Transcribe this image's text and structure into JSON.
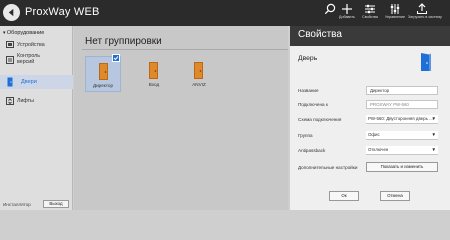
{
  "app": {
    "title": "ProxWay WEB"
  },
  "toolbar": {
    "buttons": [
      {
        "label": ""
      },
      {
        "label": "Добавить"
      },
      {
        "label": "Свойства"
      },
      {
        "label": "Управление"
      },
      {
        "label": "Загрузить в систему"
      }
    ]
  },
  "sidebar": {
    "group": "Оборудование",
    "items": [
      {
        "label": "Устройства"
      },
      {
        "label": "Контроль версий"
      }
    ],
    "doors": "Двери",
    "lifts": "Лифты",
    "user_label": "Инсталлятор",
    "logout_label": "Выход"
  },
  "main": {
    "group_title": "Нет группировки",
    "tiles": [
      {
        "label": "Директор",
        "selected": true
      },
      {
        "label": "Вход",
        "selected": false
      },
      {
        "label": "ANVIZ",
        "selected": false
      }
    ]
  },
  "panel": {
    "title": "Свойства",
    "subtitle": "Дверь",
    "fields": [
      {
        "label": "Название",
        "value": "Директор"
      },
      {
        "label": "Подключена к",
        "value": "PROXWAY PW-560"
      },
      {
        "label": "Схема подключения",
        "value": "PW-560: Двусторонняя дверь ..."
      },
      {
        "label": "Группа",
        "value": "Офис"
      },
      {
        "label": "Antipassback",
        "value": "Отключен"
      },
      {
        "label": "Дополнительные настройки",
        "value": "Показать и изменить"
      }
    ],
    "ok_label": "Ок",
    "cancel_label": "Отмена"
  },
  "colors": {
    "accent": "#1f6fd8",
    "door": "#e0892a",
    "topbar": "#2b2b2b",
    "panel_head": "#3a3a3a"
  }
}
